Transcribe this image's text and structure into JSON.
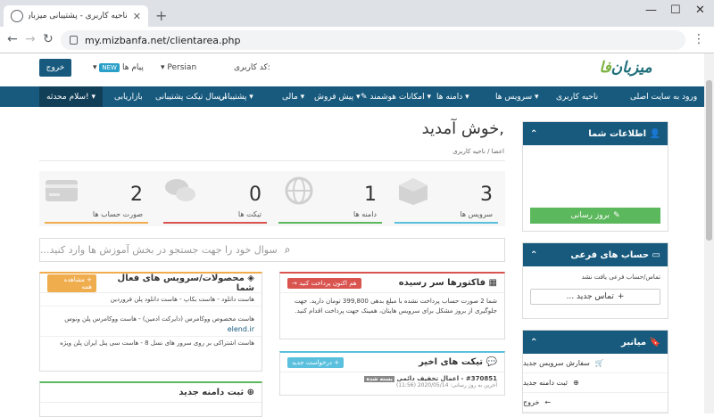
{
  "browser": {
    "tab_title": "ناحیه کاربری - پشتیبانی میزبان فا",
    "url": "my.mizbanfa.net/clientarea.php"
  },
  "header": {
    "logo_text_a": "میزبان",
    "logo_text_b": "فا",
    "customer_code_label": "کد کاربری:",
    "language": "Persian",
    "messages_label": "پیام ها",
    "new_badge": "NEW",
    "logout_label": "خروج"
  },
  "nav": {
    "items": [
      "ورود به سایت اصلی",
      "ناحیه کاربری",
      "سرویس ها",
      "دامنه ها",
      "امکانات هوشمند",
      "پیش فروش",
      "مالی",
      "پشتیبانی",
      "ارسال تیکت پشتیبانی",
      "بازاریابی"
    ],
    "hello": "سلام محدثه!"
  },
  "main": {
    "welcome": "خوش آمدید,",
    "breadcrumb_home": "اعضا",
    "breadcrumb_sep": "/",
    "breadcrumb_current": "ناحیه کاربری",
    "stats": [
      {
        "value": "3",
        "label": "سرویس ها",
        "color": "#5bc0de"
      },
      {
        "value": "1",
        "label": "دامنه ها",
        "color": "#5cb85c"
      },
      {
        "value": "0",
        "label": "تیکت ها",
        "color": "#d9534f"
      },
      {
        "value": "2",
        "label": "صورت حساب ها",
        "color": "#f0ad4e"
      }
    ],
    "search_placeholder": "سوال خود را جهت جستجو در بخش آموزش ها وارد کنید..."
  },
  "invoices": {
    "title": "فاکتورها سر رسیده",
    "pay_button": "هم اکنون پرداخت کنید",
    "body": "شما 2 صورت حساب پرداخت نشده با مبلغ بدهی 399,800 تومان دارید. جهت جلوگیری از بروز مشکل برای سرویس هایتان، همینک جهت پرداخت اقدام کنید."
  },
  "products": {
    "title": "محصولات/سرویس های فعال شما",
    "view_all": "مشاهده همه",
    "items": [
      "هاست دانلود - هاست بکاپ - هاست دانلود پلن فروردین",
      "هاست مخصوص ووکامرس (دایرکت ادمین) - هاست ووکامرس پلن ونوس",
      "elend.ir",
      "هاست اشتراکی بر روی سرور های نسل 8 - هاست سی پنل ایران پلن ویژه"
    ]
  },
  "tickets": {
    "title": "تیکت های اخیر",
    "new_button": "درخواست جدید",
    "ticket_id": "#370851",
    "ticket_subject": "اعمال تخفیف دائمی",
    "ticket_status": "بسته شده",
    "ticket_updated": "آخرین به روز رسانی: 2020/05/14 (11:56)"
  },
  "domain_register": {
    "title": "ثبت دامنه جدید"
  },
  "sidebar": {
    "info_title": "اطلاعات شما",
    "update_button": "بروز رسانی",
    "sub_title": "حساب های فرعی",
    "sub_empty": "تماس/حساب فرعی یافت نشد",
    "new_contact": "تماس جدید ...",
    "shortcuts_title": "میانبر",
    "shortcuts": [
      "سفارش سرویس جدید",
      "ثبت دامنه جدید",
      "خروج"
    ]
  }
}
